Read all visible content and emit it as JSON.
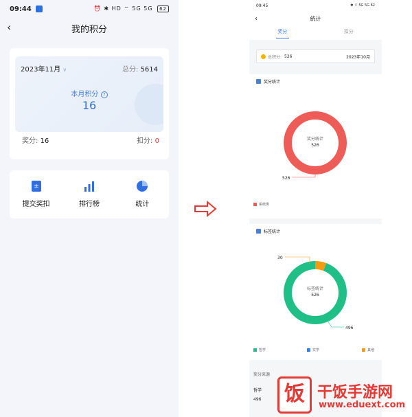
{
  "left": {
    "status": {
      "time": "09:44",
      "icons": "⏰ ✱ HD ⌔ 5G 5G",
      "battery": "62"
    },
    "nav": {
      "title": "我的积分"
    },
    "points": {
      "month": "2023年11月",
      "total_label": "总分:",
      "total_value": "5614",
      "month_label": "本月积分",
      "month_value": "16",
      "award_label": "奖分:",
      "award_value": "16",
      "deduct_label": "扣分:",
      "deduct_value": "0"
    },
    "tiles": [
      {
        "label": "提交奖扣",
        "icon": "submit-icon"
      },
      {
        "label": "排行榜",
        "icon": "bar-chart-icon"
      },
      {
        "label": "统计",
        "icon": "pie-chart-icon"
      }
    ]
  },
  "right": {
    "status": {
      "time": "09:45",
      "icons": "✱ ⌔ 5G 5G",
      "battery": "62"
    },
    "nav": {
      "title": "统计"
    },
    "tabs": [
      {
        "label": "奖分"
      },
      {
        "label": "扣分"
      }
    ],
    "total": {
      "label": "总积分:",
      "value": "526",
      "date": "2023年10月"
    },
    "award_section": {
      "title": "奖分统计",
      "center_label": "奖分统计",
      "center_value": "526",
      "callout": "526",
      "legend": [
        {
          "label": "系统类",
          "color": "#ee5c58"
        }
      ]
    },
    "tag_section": {
      "title": "标签统计",
      "center_label": "标签统计",
      "center_value": "526",
      "callout_small": "30",
      "callout_big": "496",
      "legend": [
        {
          "label": "哲学",
          "color": "#1fbf87"
        },
        {
          "label": "实学",
          "color": "#2f7fe8"
        },
        {
          "label": "其他",
          "color": "#f39c12"
        }
      ]
    },
    "source": {
      "title": "奖分来源",
      "sub": "哲学",
      "value": "496"
    }
  },
  "chart_data": [
    {
      "type": "pie",
      "title": "奖分统计",
      "categories": [
        "系统类"
      ],
      "values": [
        526
      ],
      "colors": [
        "#ee5c58"
      ]
    },
    {
      "type": "pie",
      "title": "标签统计",
      "categories": [
        "哲学",
        "实学",
        "其他"
      ],
      "values": [
        496,
        0,
        30
      ],
      "colors": [
        "#1fbf87",
        "#2f7fe8",
        "#f39c12"
      ]
    }
  ],
  "watermark": {
    "name": "干饭手游网",
    "url": "www.eduext.com",
    "logo_char": "饭"
  },
  "colors": {
    "accent": "#2f6fe0",
    "red": "#e53935"
  }
}
